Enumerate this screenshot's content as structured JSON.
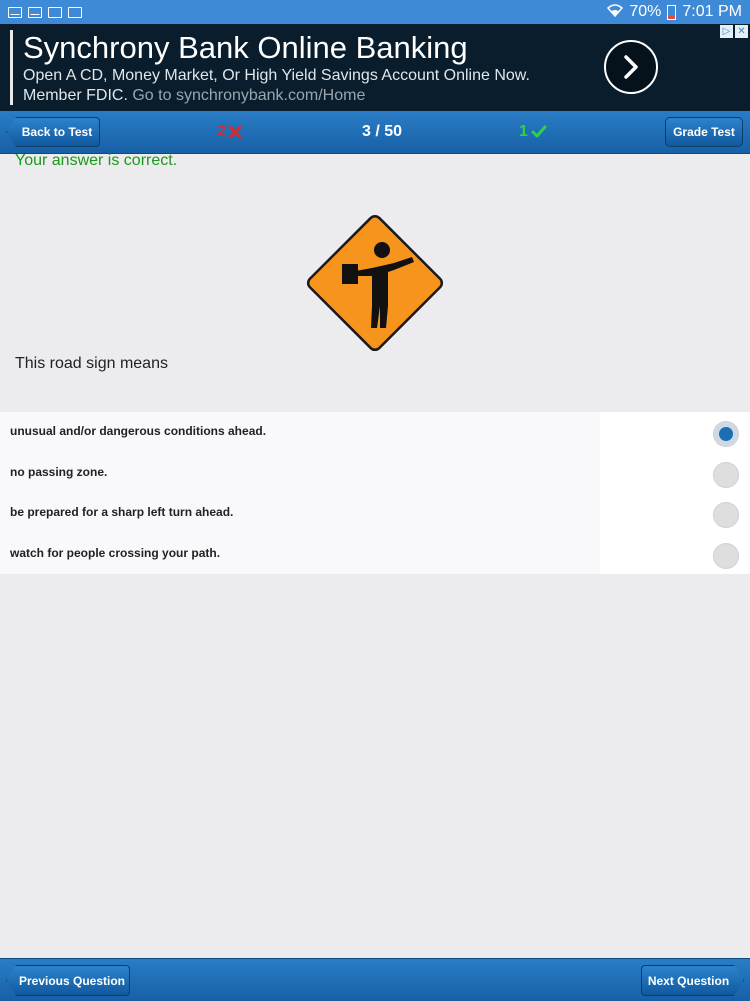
{
  "status_bar": {
    "battery": "70%",
    "time": "7:01 PM"
  },
  "ad": {
    "title": "Synchrony Bank Online Banking",
    "line1": "Open A CD, Money Market, Or High Yield Savings Account Online Now.",
    "line2_prefix": "Member FDIC.",
    "line2_link": "Go to synchronybank.com/Home"
  },
  "toolbar": {
    "back_label": "Back to Test",
    "wrong_count": "2",
    "progress": "3 / 50",
    "right_count": "1",
    "grade_label": "Grade Test"
  },
  "content": {
    "result_text": "Your answer is correct.",
    "question": "This road sign means",
    "answers": [
      {
        "label": "unusual and/or dangerous conditions ahead.",
        "selected": true
      },
      {
        "label": "no passing zone.",
        "selected": false
      },
      {
        "label": "be prepared for a sharp left turn ahead.",
        "selected": false
      },
      {
        "label": "watch for people crossing your path.",
        "selected": false
      }
    ]
  },
  "bottom": {
    "prev_label": "Previous Question",
    "next_label": "Next Question"
  },
  "colors": {
    "bar_blue": "#1f6fb8",
    "correct_green": "#1a9a1a",
    "wrong_red": "#d72b2b",
    "sign_orange": "#f7941d"
  },
  "icons": [
    "mail-icon",
    "image-icon",
    "wifi-icon",
    "battery-icon",
    "chevron-right-icon",
    "flagger-sign-icon",
    "x-mark-icon",
    "check-mark-icon"
  ]
}
